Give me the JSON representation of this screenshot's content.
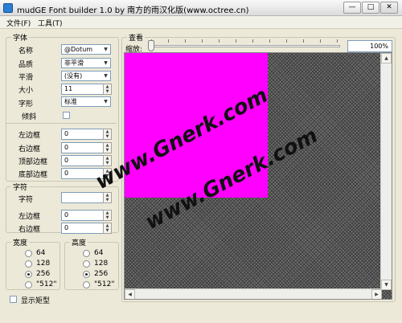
{
  "window": {
    "title": "mudGE Font builder 1.0 by 南方的雨汉化版(www.octree.cn)"
  },
  "menu": [
    "文件(F)",
    "工具(T)"
  ],
  "font_group": {
    "title": "字体",
    "name_label": "名称",
    "name_value": "@Dotum",
    "quality_label": "品质",
    "quality_value": "非平滑",
    "smooth_label": "平滑",
    "smooth_value": "(没有)",
    "size_label": "大小",
    "size_value": "11",
    "style_label": "字形",
    "style_value": "标准",
    "italic_label": "倾斜",
    "left_margin_label": "左边框",
    "left_margin_value": "0",
    "right_margin_label": "右边框",
    "right_margin_value": "0",
    "top_margin_label": "顶部边框",
    "top_margin_value": "0",
    "bottom_margin_label": "底部边框",
    "bottom_margin_value": "0"
  },
  "char_group": {
    "title": "字符",
    "char_label": "字符",
    "char_value": "",
    "left_margin_label": "左边框",
    "left_margin_value": "0",
    "right_margin_label": "右边框",
    "right_margin_value": "0"
  },
  "width_group": {
    "title": "宽度",
    "options": [
      "64",
      "128",
      "256",
      "\"512\""
    ],
    "selected": "256"
  },
  "height_group": {
    "title": "高度",
    "options": [
      "64",
      "128",
      "256",
      "\"512\""
    ],
    "selected": "256"
  },
  "show_rect_label": "显示矩型",
  "view": {
    "title": "查看",
    "zoom_label": "缩放:",
    "zoom_value": "100%"
  },
  "watermark": "www.Gnerk.com",
  "colors": {
    "glyph_fill": "#ff00ff"
  }
}
